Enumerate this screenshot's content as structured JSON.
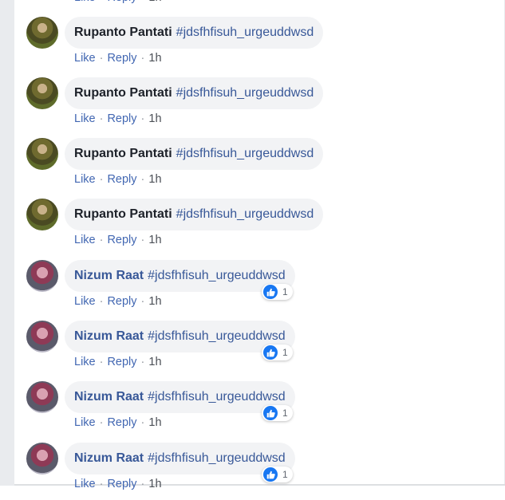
{
  "comments": [
    {
      "author": "Rupanto Pantati",
      "text": "#jdsfhfisuh_urgeuddwsd",
      "like": "Like",
      "reply": "Reply",
      "time": "1h",
      "sep": "·",
      "reactions": null,
      "avatar": "olive",
      "author_color": "#1d2129"
    },
    {
      "author": "Rupanto Pantati",
      "text": "#jdsfhfisuh_urgeuddwsd",
      "like": "Like",
      "reply": "Reply",
      "time": "1h",
      "sep": "·",
      "reactions": null,
      "avatar": "olive",
      "author_color": "#1d2129"
    },
    {
      "author": "Rupanto Pantati",
      "text": "#jdsfhfisuh_urgeuddwsd",
      "like": "Like",
      "reply": "Reply",
      "time": "1h",
      "sep": "·",
      "reactions": null,
      "avatar": "olive",
      "author_color": "#1d2129"
    },
    {
      "author": "Rupanto Pantati",
      "text": "#jdsfhfisuh_urgeuddwsd",
      "like": "Like",
      "reply": "Reply",
      "time": "1h",
      "sep": "·",
      "reactions": null,
      "avatar": "olive",
      "author_color": "#1d2129"
    },
    {
      "author": "Nizum Raat",
      "text": "#jdsfhfisuh_urgeuddwsd",
      "like": "Like",
      "reply": "Reply",
      "time": "1h",
      "sep": "·",
      "reactions": "1",
      "avatar": "pink",
      "author_color": "#385898"
    },
    {
      "author": "Nizum Raat",
      "text": "#jdsfhfisuh_urgeuddwsd",
      "like": "Like",
      "reply": "Reply",
      "time": "1h",
      "sep": "·",
      "reactions": "1",
      "avatar": "pink",
      "author_color": "#385898"
    },
    {
      "author": "Nizum Raat",
      "text": "#jdsfhfisuh_urgeuddwsd",
      "like": "Like",
      "reply": "Reply",
      "time": "1h",
      "sep": "·",
      "reactions": "1",
      "avatar": "pink",
      "author_color": "#385898"
    },
    {
      "author": "Nizum Raat",
      "text": "#jdsfhfisuh_urgeuddwsd",
      "like": "Like",
      "reply": "Reply",
      "time": "1h",
      "sep": "·",
      "reactions": "1",
      "avatar": "pink",
      "author_color": "#385898"
    }
  ],
  "colors": {
    "link": "#4267b2",
    "bubble": "#f2f3f5",
    "like_badge": "#1877f2"
  },
  "icons": {
    "reaction": "thumbs-up-icon"
  }
}
